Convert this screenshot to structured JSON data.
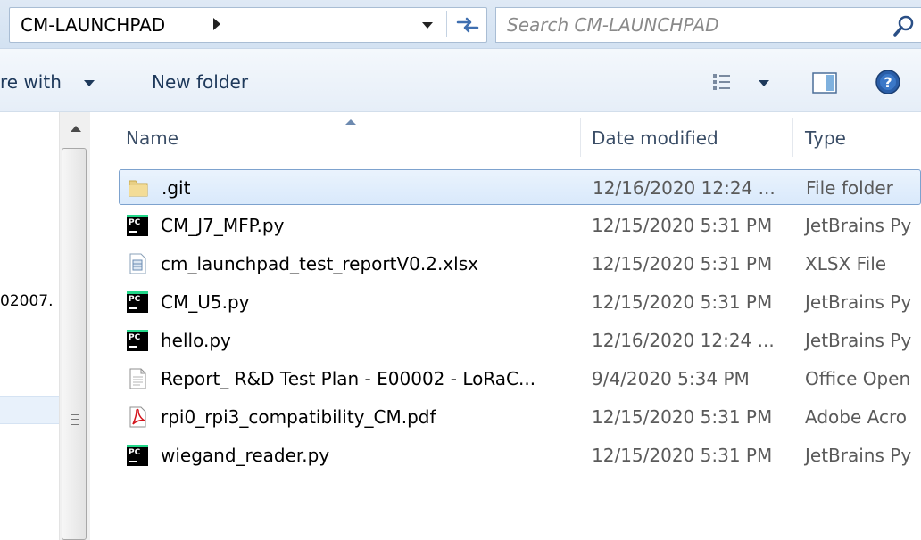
{
  "address": {
    "path": "CM-LAUNCHPAD",
    "search_placeholder": "Search CM-LAUNCHPAD"
  },
  "toolbar": {
    "share_label": "re with",
    "new_folder_label": "New folder"
  },
  "nav": {
    "truncated_item": "02007."
  },
  "columns": {
    "name": "Name",
    "date": "Date modified",
    "type": "Type"
  },
  "files": [
    {
      "name": ".git",
      "date": "12/16/2020 12:24 ...",
      "type": "File folder",
      "icon": "folder-icon"
    },
    {
      "name": "CM_J7_MFP.py",
      "date": "12/15/2020 5:31 PM",
      "type": "JetBrains Py",
      "icon": "pycharm-file-icon"
    },
    {
      "name": "cm_launchpad_test_reportV0.2.xlsx",
      "date": "12/15/2020 5:31 PM",
      "type": "XLSX File",
      "icon": "xlsx-file-icon"
    },
    {
      "name": "CM_U5.py",
      "date": "12/15/2020 5:31 PM",
      "type": "JetBrains Py",
      "icon": "pycharm-file-icon"
    },
    {
      "name": "hello.py",
      "date": "12/16/2020 12:24 ...",
      "type": "JetBrains Py",
      "icon": "pycharm-file-icon"
    },
    {
      "name": "Report_ R&D Test Plan - E00002 - LoRaC...",
      "date": "9/4/2020 5:34 PM",
      "type": "Office Open",
      "icon": "document-file-icon"
    },
    {
      "name": "rpi0_rpi3_compatibility_CM.pdf",
      "date": "12/15/2020 5:31 PM",
      "type": "Adobe Acro",
      "icon": "pdf-file-icon"
    },
    {
      "name": "wiegand_reader.py",
      "date": "12/15/2020 5:31 PM",
      "type": "JetBrains Py",
      "icon": "pycharm-file-icon"
    }
  ],
  "colors": {
    "selection_border": "#7da2ce",
    "header_text": "#3a4d66",
    "toolbar_text": "#1e395b"
  }
}
